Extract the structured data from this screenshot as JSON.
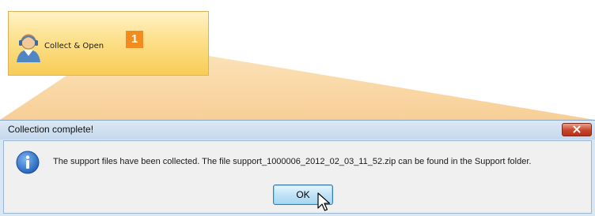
{
  "ribbon": {
    "button_label": "Collect & Open",
    "button_icon": "support-agent-icon",
    "step_badge": "1",
    "step_badge_color": "#f28c1e"
  },
  "dialog": {
    "title": "Collection complete!",
    "icon": "info-icon",
    "message": "The support files have been collected. The file support_1000006_2012_02_03_11_52.zip can be found in the Support folder.",
    "ok_label": "OK",
    "close_icon": "close-icon"
  }
}
